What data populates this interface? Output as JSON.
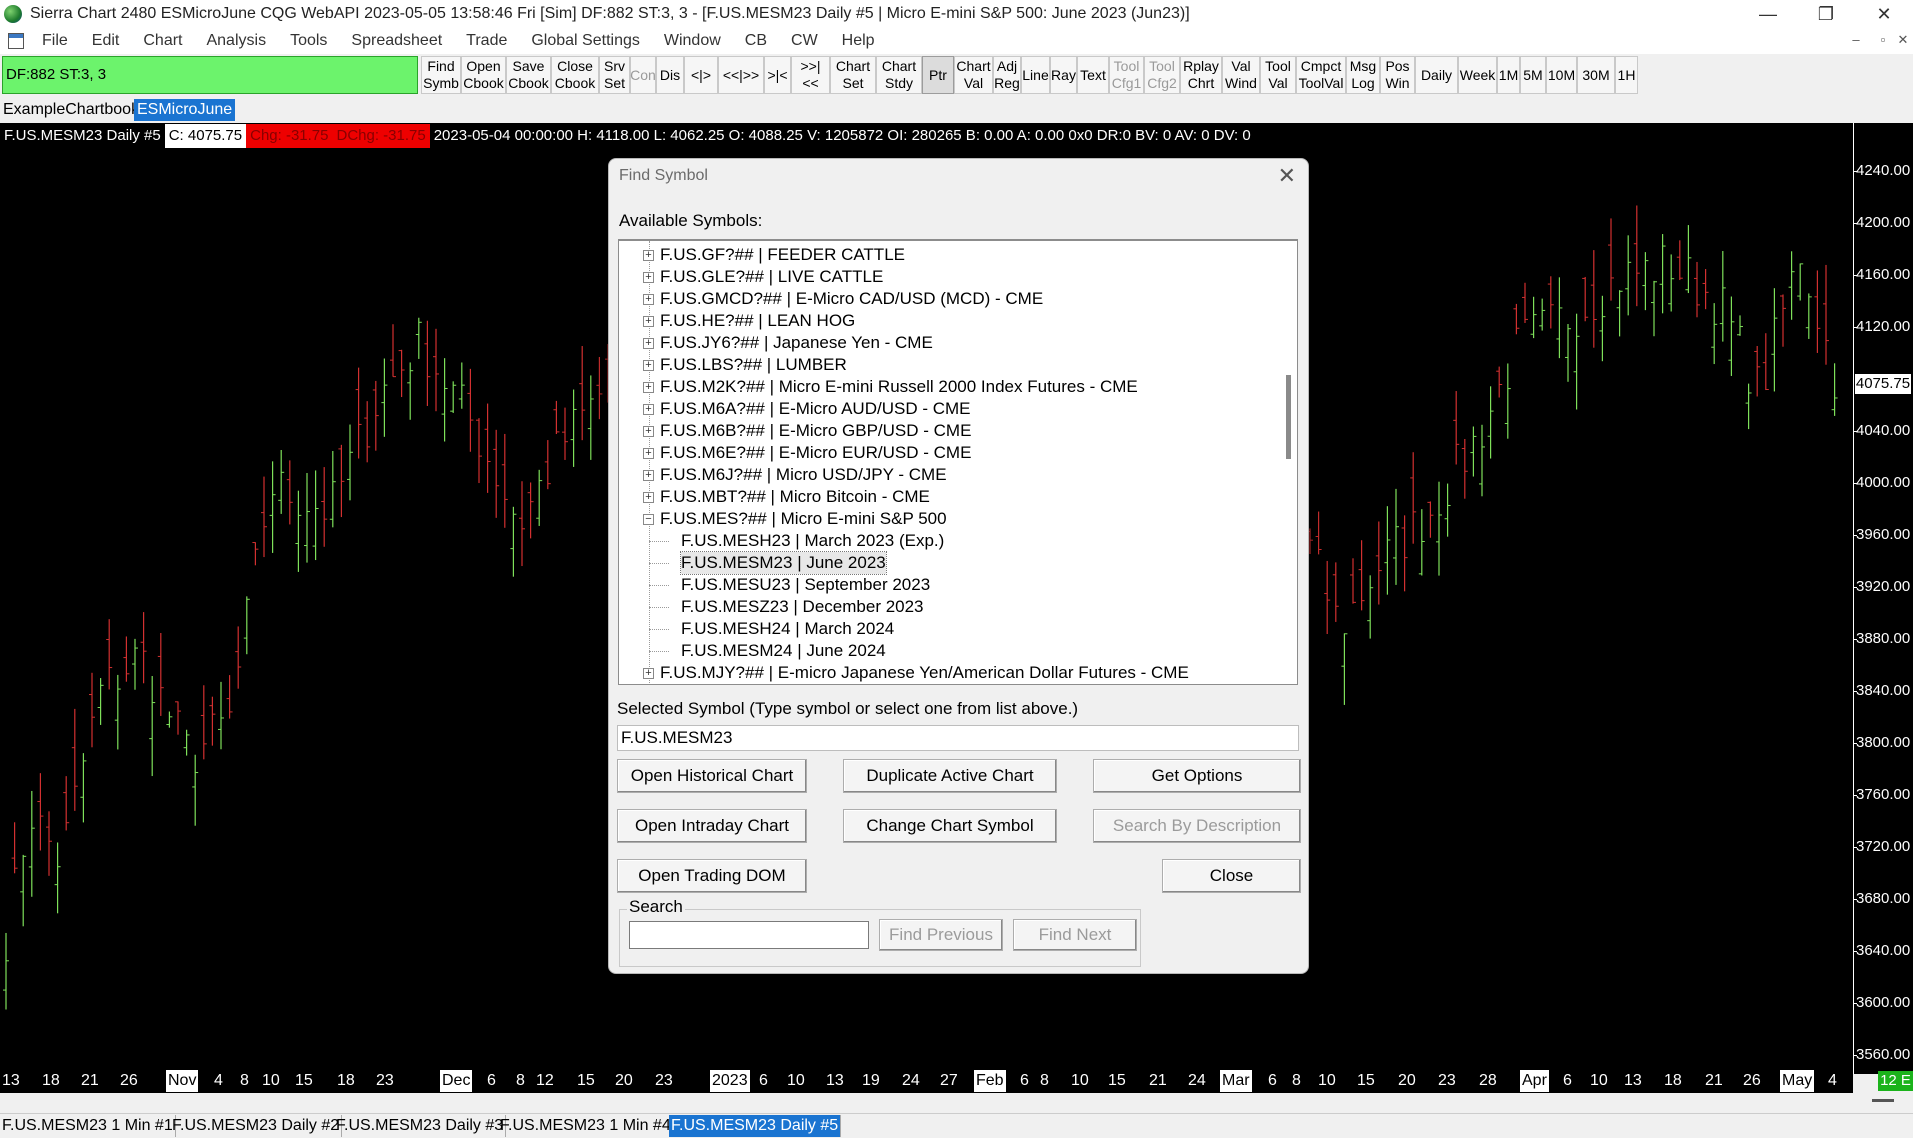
{
  "titlebar": {
    "title": "Sierra Chart 2480 ESMicroJune  CQG WebAPI 2023-05-05  13:58:46 Fri [Sim]  DF:882  ST:3, 3 - [F.US.MESM23  Daily  #5 | Micro E-mini S&P 500: June 2023 (Jun23)]",
    "minimize": "—",
    "restore": "❐",
    "close": "✕"
  },
  "menu": [
    "File",
    "Edit",
    "Chart",
    "Analysis",
    "Tools",
    "Spreadsheet",
    "Trade",
    "Global Settings",
    "Window",
    "CB",
    "CW",
    "Help"
  ],
  "mdi_controls": [
    "–",
    "▫",
    "✕"
  ],
  "status_box": "DF:882  ST:3, 3",
  "toolbar": [
    {
      "label": "Find\nSymb",
      "state": "normal"
    },
    {
      "label": "Open\nCbook",
      "state": "normal"
    },
    {
      "label": "Save\nCbook",
      "state": "normal"
    },
    {
      "label": "Close\nCbook",
      "state": "normal"
    },
    {
      "label": "Srv\nSet",
      "state": "normal"
    },
    {
      "label": "Con",
      "state": "disabled"
    },
    {
      "label": "Dis",
      "state": "normal"
    },
    {
      "label": "<|>",
      "state": "normal"
    },
    {
      "label": "<<|>>",
      "state": "normal"
    },
    {
      "label": ">|<",
      "state": "normal"
    },
    {
      "label": ">>|<<",
      "state": "normal"
    },
    {
      "label": "Chart\nSet",
      "state": "normal"
    },
    {
      "label": "Chart\nStdy",
      "state": "normal"
    },
    {
      "label": "Ptr",
      "state": "selected"
    },
    {
      "label": "Chart\nVal",
      "state": "normal"
    },
    {
      "label": "Adj\nReg",
      "state": "normal"
    },
    {
      "label": "Line",
      "state": "normal"
    },
    {
      "label": "Ray",
      "state": "normal"
    },
    {
      "label": "Text",
      "state": "normal"
    },
    {
      "label": "Tool\nCfg1",
      "state": "disabled"
    },
    {
      "label": "Tool\nCfg2",
      "state": "disabled"
    },
    {
      "label": "Rplay\nChrt",
      "state": "normal"
    },
    {
      "label": "Val\nWind",
      "state": "normal"
    },
    {
      "label": "Tool\nVal",
      "state": "normal"
    },
    {
      "label": "Cmpct\nToolVal",
      "state": "normal"
    },
    {
      "label": "Msg\nLog",
      "state": "normal"
    },
    {
      "label": "Pos\nWin",
      "state": "normal"
    },
    {
      "label": "Daily",
      "state": "normal"
    },
    {
      "label": "Week",
      "state": "normal"
    },
    {
      "label": "1M",
      "state": "normal"
    },
    {
      "label": "5M",
      "state": "normal"
    },
    {
      "label": "10M",
      "state": "normal"
    },
    {
      "label": "30M",
      "state": "normal"
    },
    {
      "label": "1H",
      "state": "normal"
    }
  ],
  "chartbook_tabs": [
    "ExampleChartbook",
    "ESMicroJune"
  ],
  "chart_info": {
    "symbol": "F.US.MESM23  Daily  #5",
    "close": "C: 4075.75",
    "chg": "Chg: -31.75",
    "dchg": "DChg: -31.75",
    "rest": "2023-05-04 00:00:00 H: 4118.00 L: 4062.25 O: 4088.25 V: 1205872 OI: 280265 B: 0.00 A: 0.00 0x0 DR:0 BV: 0 AV: 0 DV: 0"
  },
  "price_axis": {
    "labels": [
      "4240.00",
      "4200.00",
      "4160.00",
      "4120.00",
      "4040.00",
      "4000.00",
      "3960.00",
      "3920.00",
      "3880.00",
      "3840.00",
      "3800.00",
      "3760.00",
      "3720.00",
      "3680.00",
      "3640.00",
      "3600.00",
      "3560.00"
    ],
    "last_price": "4075.75"
  },
  "date_axis": [
    {
      "t": "13",
      "m": false
    },
    {
      "t": "18",
      "m": false
    },
    {
      "t": "21",
      "m": false
    },
    {
      "t": "26",
      "m": false
    },
    {
      "t": "Nov",
      "m": true
    },
    {
      "t": "4",
      "m": false
    },
    {
      "t": "8",
      "m": false
    },
    {
      "t": "10",
      "m": false
    },
    {
      "t": "15",
      "m": false
    },
    {
      "t": "18",
      "m": false
    },
    {
      "t": "23",
      "m": false
    },
    {
      "t": "Dec",
      "m": true
    },
    {
      "t": "6",
      "m": false
    },
    {
      "t": "8",
      "m": false
    },
    {
      "t": "12",
      "m": false
    },
    {
      "t": "15",
      "m": false
    },
    {
      "t": "20",
      "m": false
    },
    {
      "t": "23",
      "m": false
    },
    {
      "t": "2023",
      "m": true
    },
    {
      "t": "6",
      "m": false
    },
    {
      "t": "10",
      "m": false
    },
    {
      "t": "13",
      "m": false
    },
    {
      "t": "19",
      "m": false
    },
    {
      "t": "24",
      "m": false
    },
    {
      "t": "27",
      "m": false
    },
    {
      "t": "Feb",
      "m": true
    },
    {
      "t": "6",
      "m": false
    },
    {
      "t": "8",
      "m": false
    },
    {
      "t": "10",
      "m": false
    },
    {
      "t": "15",
      "m": false
    },
    {
      "t": "21",
      "m": false
    },
    {
      "t": "24",
      "m": false
    },
    {
      "t": "Mar",
      "m": true
    },
    {
      "t": "6",
      "m": false
    },
    {
      "t": "8",
      "m": false
    },
    {
      "t": "10",
      "m": false
    },
    {
      "t": "15",
      "m": false
    },
    {
      "t": "20",
      "m": false
    },
    {
      "t": "23",
      "m": false
    },
    {
      "t": "28",
      "m": false
    },
    {
      "t": "Apr",
      "m": true
    },
    {
      "t": "6",
      "m": false
    },
    {
      "t": "10",
      "m": false
    },
    {
      "t": "13",
      "m": false
    },
    {
      "t": "18",
      "m": false
    },
    {
      "t": "21",
      "m": false
    },
    {
      "t": "26",
      "m": false
    },
    {
      "t": "May",
      "m": true
    },
    {
      "t": "4",
      "m": false
    }
  ],
  "bars_count": "12 E",
  "bottom_tabs": [
    {
      "label": "F.US.MESM23  1 Min   #1",
      "active": false
    },
    {
      "label": "F.US.MESM23  Daily  #2",
      "active": false
    },
    {
      "label": "F.US.MESM23  Daily  #3",
      "active": false
    },
    {
      "label": "F.US.MESM23  1 Min   #4",
      "active": false
    },
    {
      "label": "F.US.MESM23  Daily  #5",
      "active": true
    }
  ],
  "dialog": {
    "title": "Find Symbol",
    "close_glyph": "✕",
    "available_label": "Available Symbols:",
    "tree": [
      {
        "text": "F.US.GF?##  |  FEEDER CATTLE",
        "level": 0,
        "expander": "+"
      },
      {
        "text": "F.US.GLE?##  |  LIVE CATTLE",
        "level": 0,
        "expander": "+"
      },
      {
        "text": "F.US.GMCD?##  |  E-Micro CAD/USD (MCD) - CME",
        "level": 0,
        "expander": "+"
      },
      {
        "text": "F.US.HE?##  |  LEAN HOG",
        "level": 0,
        "expander": "+"
      },
      {
        "text": "F.US.JY6?##  |  Japanese Yen - CME",
        "level": 0,
        "expander": "+"
      },
      {
        "text": "F.US.LBS?##  |  LUMBER",
        "level": 0,
        "expander": "+"
      },
      {
        "text": "F.US.M2K?##  |  Micro E-mini Russell 2000 Index Futures - CME",
        "level": 0,
        "expander": "+"
      },
      {
        "text": "F.US.M6A?##  |  E-Micro AUD/USD - CME",
        "level": 0,
        "expander": "+"
      },
      {
        "text": "F.US.M6B?##  |  E-Micro GBP/USD - CME",
        "level": 0,
        "expander": "+"
      },
      {
        "text": "F.US.M6E?##  |  E-Micro EUR/USD - CME",
        "level": 0,
        "expander": "+"
      },
      {
        "text": "F.US.M6J?##  |  Micro USD/JPY - CME",
        "level": 0,
        "expander": "+"
      },
      {
        "text": "F.US.MBT?##  |  Micro Bitcoin - CME",
        "level": 0,
        "expander": "+"
      },
      {
        "text": "F.US.MES?##  |  Micro E-mini S&P 500",
        "level": 0,
        "expander": "−"
      },
      {
        "text": "F.US.MESH23  |  March 2023 (Exp.)",
        "level": 1,
        "expander": ""
      },
      {
        "text": "F.US.MESM23  |  June 2023",
        "level": 1,
        "expander": "",
        "selected": true
      },
      {
        "text": "F.US.MESU23  |  September 2023",
        "level": 1,
        "expander": ""
      },
      {
        "text": "F.US.MESZ23  |  December 2023",
        "level": 1,
        "expander": ""
      },
      {
        "text": "F.US.MESH24  |  March 2024",
        "level": 1,
        "expander": ""
      },
      {
        "text": "F.US.MESM24  |  June 2024",
        "level": 1,
        "expander": ""
      },
      {
        "text": "F.US.MJY?##  |  E-micro Japanese Yen/American Dollar Futures - CME",
        "level": 0,
        "expander": "+"
      }
    ],
    "selected_label": "Selected Symbol (Type symbol or select one from list above.)",
    "selected_value": "F.US.MESM23",
    "buttons": {
      "open_historical": "Open Historical Chart",
      "duplicate_active": "Duplicate Active Chart",
      "get_options": "Get Options",
      "open_intraday": "Open Intraday Chart",
      "change_symbol": "Change Chart Symbol",
      "search_by_desc": "Search By Description",
      "open_dom": "Open Trading DOM",
      "close": "Close",
      "find_previous": "Find Previous",
      "find_next": "Find Next"
    },
    "search_group_label": "Search",
    "search_value": ""
  },
  "colors": {
    "up_bar": "#7ee05a",
    "down_bar": "#d23030",
    "accent": "#1a74d1",
    "status_green": "#6cf36c"
  }
}
